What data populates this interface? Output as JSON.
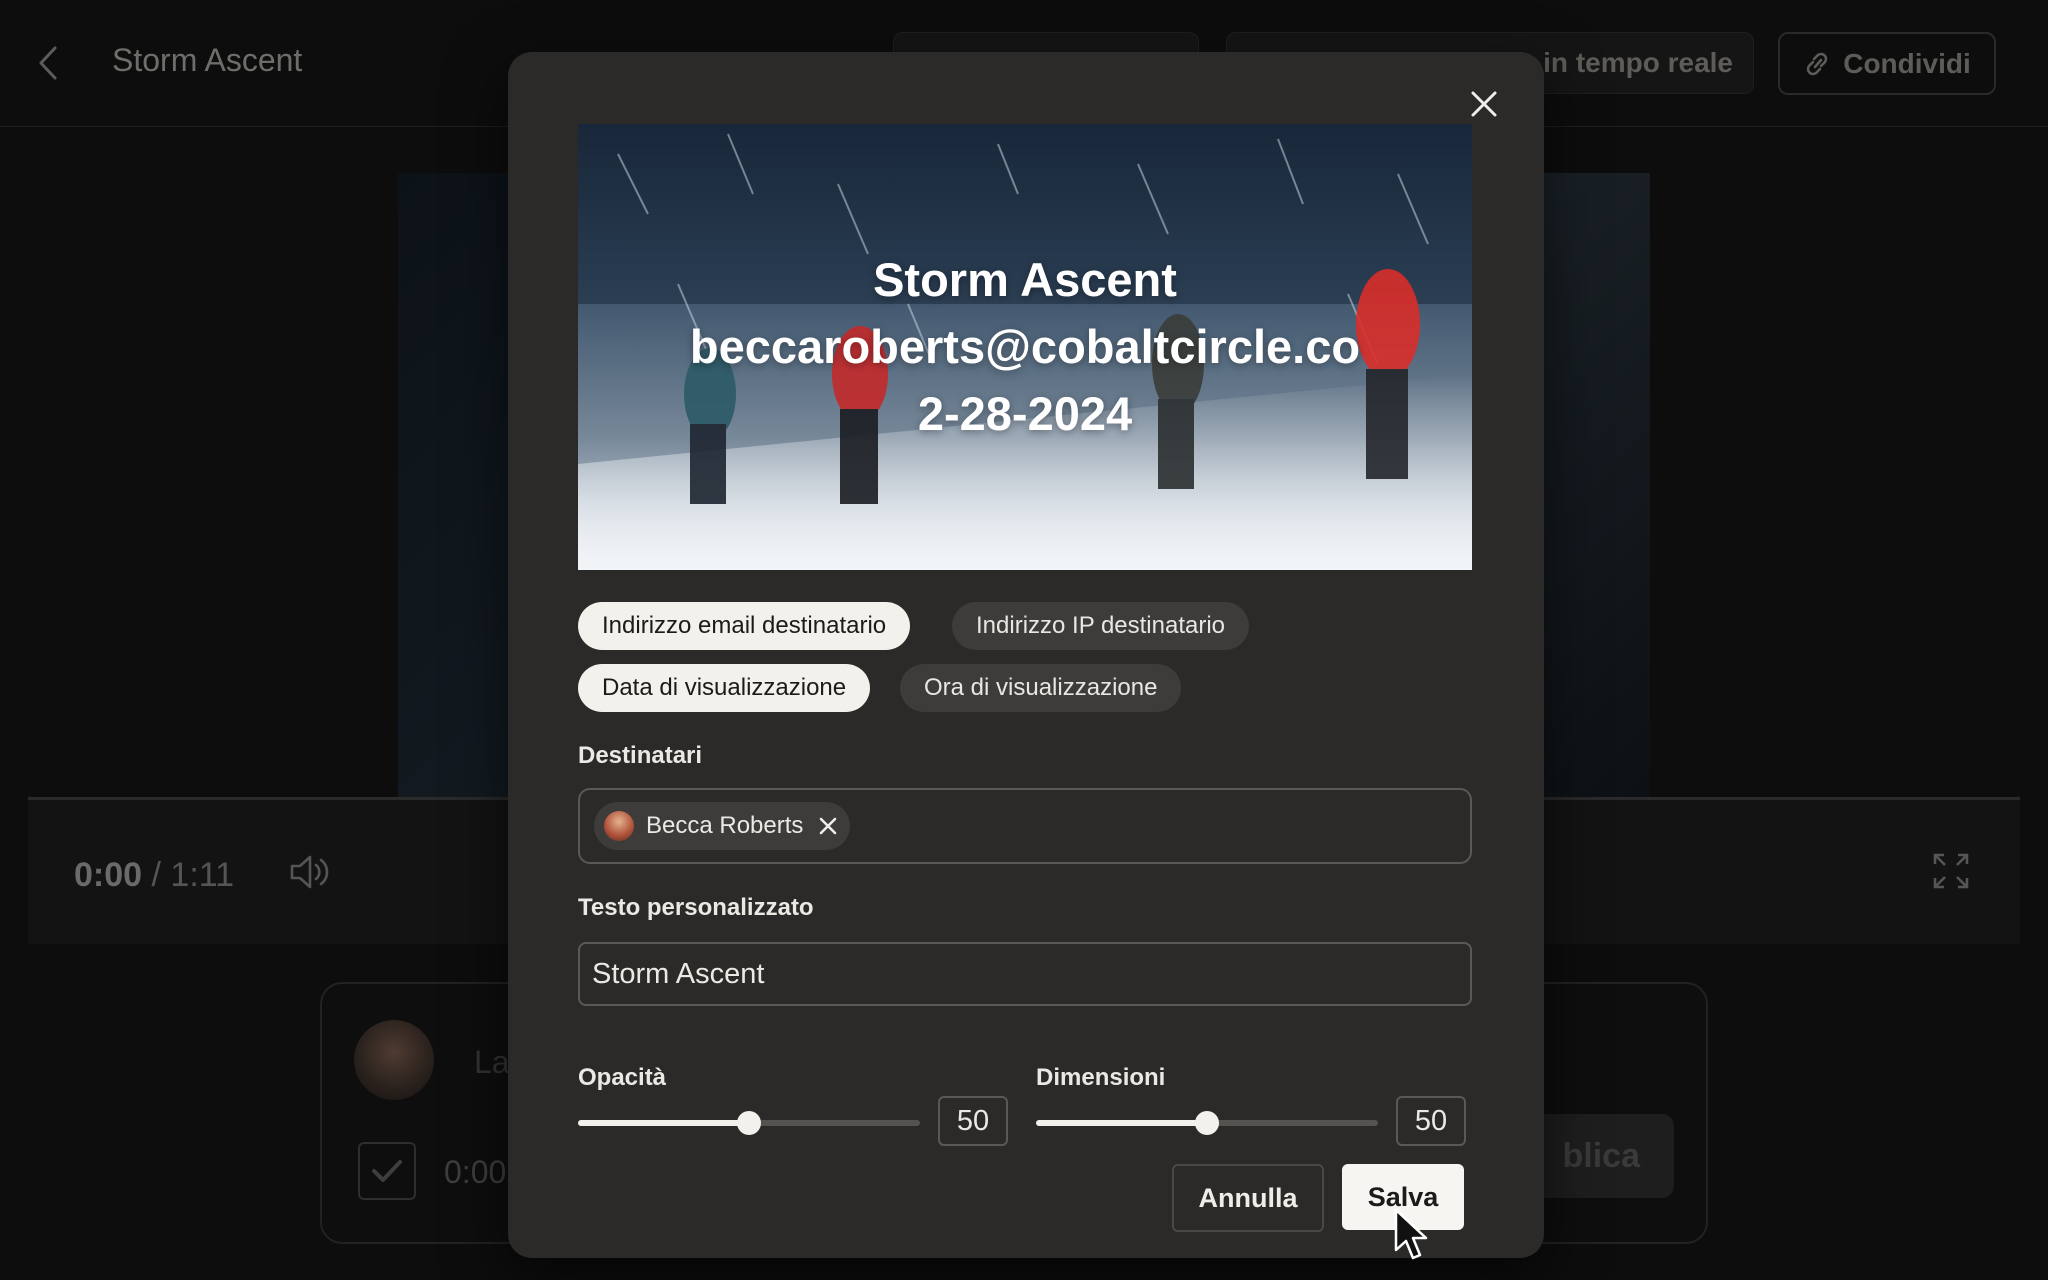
{
  "app": {
    "title": "Storm Ascent",
    "header_button_a": "",
    "header_button_b": "in tempo reale",
    "share_label": "Condividi"
  },
  "player": {
    "current_time": "0:00",
    "duration": "/ 1:11"
  },
  "comment": {
    "placeholder": "La",
    "timestamp": "0:00",
    "publish_label": "blica"
  },
  "modal": {
    "watermark_lines": [
      "Storm Ascent",
      "beccaroberts@cobaltcircle.co",
      "2-28-2024"
    ],
    "options": [
      {
        "label": "Indirizzo email destinatario",
        "selected": true
      },
      {
        "label": "Indirizzo IP destinatario",
        "selected": false
      },
      {
        "label": "Data di visualizzazione",
        "selected": true
      },
      {
        "label": "Ora di visualizzazione",
        "selected": false
      }
    ],
    "recipients_label": "Destinatari",
    "recipients": [
      {
        "name": "Becca Roberts"
      }
    ],
    "custom_text_label": "Testo personalizzato",
    "custom_text_value": "Storm Ascent",
    "opacity": {
      "label": "Opacità",
      "value": 50
    },
    "size": {
      "label": "Dimensioni",
      "value": 50
    },
    "cancel_label": "Annulla",
    "save_label": "Salva"
  },
  "colors": {
    "modal_bg": "#2b2a28",
    "chip_selected": "#f3f1ec",
    "chip_unselected": "#3d3c3a",
    "accent_light": "#f7f5f1"
  }
}
